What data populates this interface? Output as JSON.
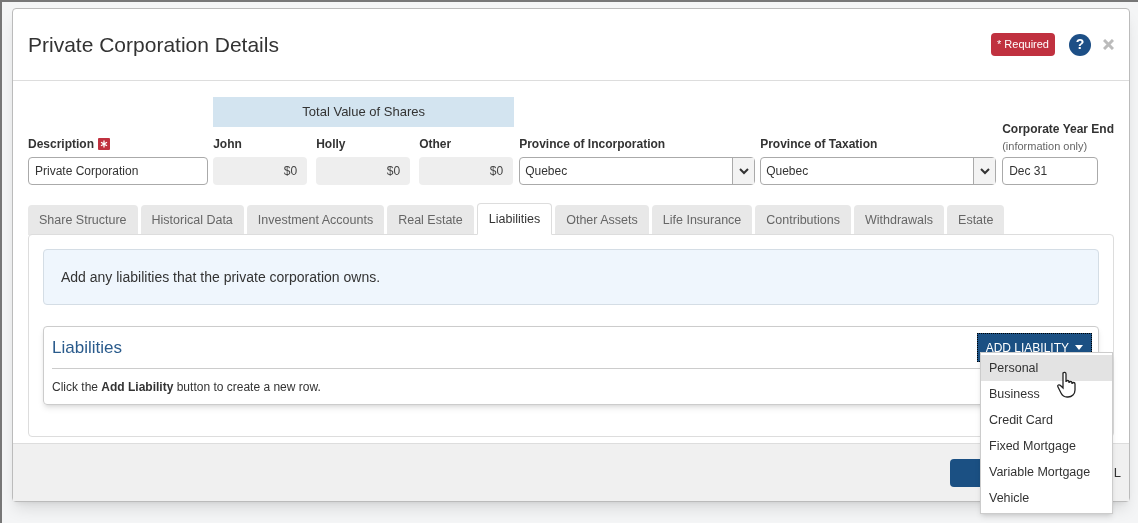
{
  "dialog": {
    "title": "Private Corporation Details",
    "required_badge": "* Required",
    "help_button": "?"
  },
  "form": {
    "description": {
      "label": "Description",
      "required": true,
      "value": "Private Corporation"
    },
    "shares_header": "Total Value of Shares",
    "shares": [
      {
        "label": "John",
        "value": "$0"
      },
      {
        "label": "Holly",
        "value": "$0"
      },
      {
        "label": "Other",
        "value": "$0"
      }
    ],
    "province_incorporation": {
      "label": "Province of Incorporation",
      "value": "Quebec"
    },
    "province_taxation": {
      "label": "Province of Taxation",
      "value": "Quebec"
    },
    "year_end": {
      "label": "Corporate Year End",
      "note": "(information only)",
      "value": "Dec 31"
    }
  },
  "tabs": [
    {
      "label": "Share Structure",
      "selected": false
    },
    {
      "label": "Historical Data",
      "selected": false
    },
    {
      "label": "Investment Accounts",
      "selected": false
    },
    {
      "label": "Real Estate",
      "selected": false
    },
    {
      "label": "Liabilities",
      "selected": true
    },
    {
      "label": "Other Assets",
      "selected": false
    },
    {
      "label": "Life Insurance",
      "selected": false
    },
    {
      "label": "Contributions",
      "selected": false
    },
    {
      "label": "Withdrawals",
      "selected": false
    },
    {
      "label": "Estate",
      "selected": false
    }
  ],
  "info_text": "Add any liabilities that the private corporation owns.",
  "liabilities": {
    "title": "Liabilities",
    "add_button": "ADD LIABILITY",
    "hint": "Click the **Add Liability** button to create a new row.",
    "menu": [
      {
        "label": "Personal",
        "highlighted": true
      },
      {
        "label": "Business",
        "highlighted": false
      },
      {
        "label": "Credit Card",
        "highlighted": false
      },
      {
        "label": "Fixed Mortgage",
        "highlighted": false
      },
      {
        "label": "Variable Mortgage",
        "highlighted": false
      },
      {
        "label": "Vehicle",
        "highlighted": false
      }
    ]
  },
  "footer": {
    "cancel_fragment": "L"
  }
}
